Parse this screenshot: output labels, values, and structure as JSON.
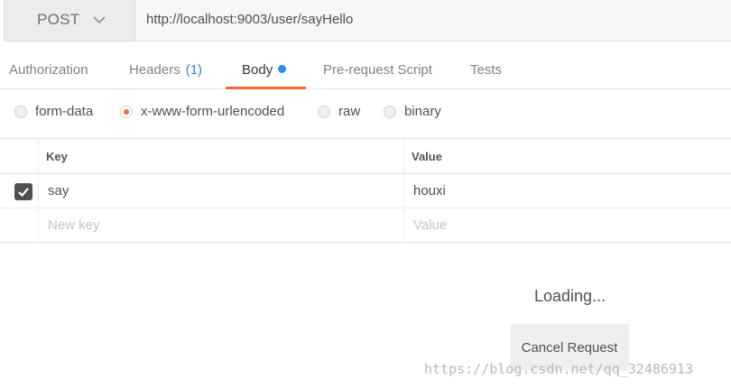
{
  "request": {
    "method": "POST",
    "url": "http://localhost:9003/user/sayHello"
  },
  "tabs": [
    {
      "label": "Authorization"
    },
    {
      "label": "Headers",
      "count": "(1)"
    },
    {
      "label": "Body",
      "active": true
    },
    {
      "label": "Pre-request Script"
    },
    {
      "label": "Tests"
    }
  ],
  "body_types": [
    {
      "label": "form-data",
      "checked": false
    },
    {
      "label": "x-www-form-urlencoded",
      "checked": true
    },
    {
      "label": "raw",
      "checked": false
    },
    {
      "label": "binary",
      "checked": false
    }
  ],
  "table": {
    "headers": {
      "key": "Key",
      "value": "Value"
    },
    "rows": [
      {
        "key": "say",
        "value": "houxi",
        "checked": true
      }
    ],
    "new_row": {
      "key_placeholder": "New key",
      "value_placeholder": "Value"
    }
  },
  "status": {
    "loading": "Loading...",
    "cancel_label": "Cancel Request"
  },
  "watermark": "https://blog.csdn.net/qq_32486913",
  "colors": {
    "accent": "#f26b3a",
    "dot": "#1f8ff0",
    "count": "#3f7fd0"
  },
  "icons": {
    "method_dropdown": "chevron-down-icon",
    "row_check": "checkmark-icon",
    "body_indicator": "dot-icon"
  }
}
